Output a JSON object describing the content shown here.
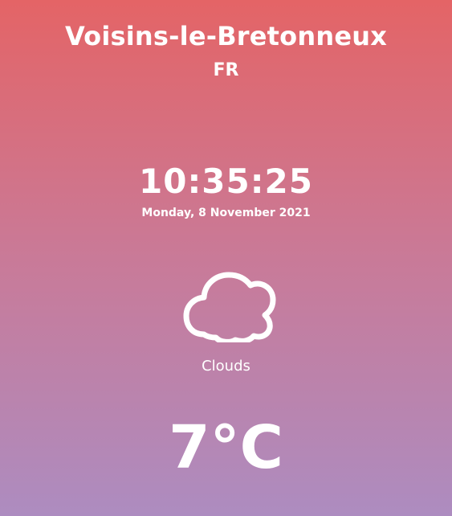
{
  "location": {
    "city": "Voisins-le-Bretonneux",
    "country": "FR"
  },
  "clock": {
    "time": "10:35:25",
    "date": "Monday, 8 November 2021"
  },
  "weather": {
    "icon": "cloud-icon",
    "condition": "Clouds",
    "temperature": "7°C"
  },
  "colors": {
    "gradient_top": "#e46466",
    "gradient_middle": "#c97a98",
    "gradient_bottom": "#ad8cc0",
    "text": "#ffffff"
  }
}
